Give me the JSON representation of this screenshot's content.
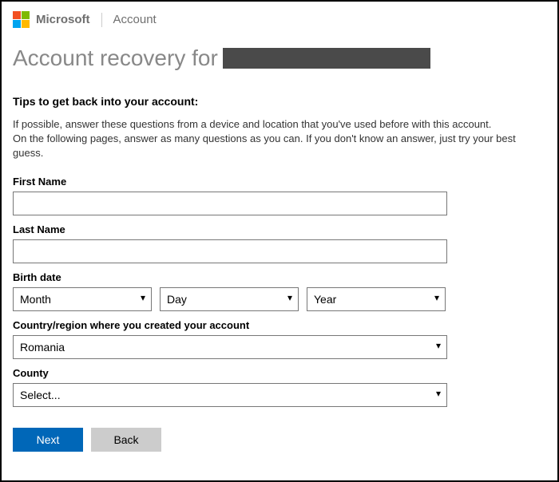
{
  "header": {
    "brand": "Microsoft",
    "section": "Account"
  },
  "title_prefix": "Account recovery for",
  "tips": {
    "heading": "Tips to get back into your account:",
    "line1": "If possible, answer these questions from a device and location that you've used before with this account.",
    "line2": "On the following pages, answer as many questions as you can. If you don't know an answer, just try your best guess."
  },
  "form": {
    "first_name": {
      "label": "First Name",
      "value": ""
    },
    "last_name": {
      "label": "Last Name",
      "value": ""
    },
    "birth_date": {
      "label": "Birth date",
      "month": "Month",
      "day": "Day",
      "year": "Year"
    },
    "country": {
      "label": "Country/region where you created your account",
      "value": "Romania"
    },
    "county": {
      "label": "County",
      "value": "Select..."
    }
  },
  "buttons": {
    "next": "Next",
    "back": "Back"
  }
}
